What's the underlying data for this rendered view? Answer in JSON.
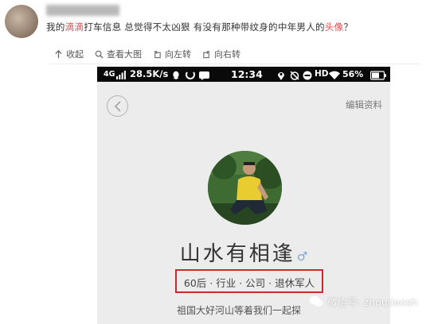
{
  "post": {
    "text_before": "我的",
    "highlight_1": "滴滴",
    "text_middle": "打车信息 总觉得不太凶狠 有没有那种带纹身的中年男人的",
    "highlight_2": "头像",
    "text_after": "？"
  },
  "actions": {
    "collapse": "收起",
    "view_large": "查看大图",
    "rotate_left": "向左转",
    "rotate_right": "向右转"
  },
  "status_bar": {
    "network": "4G",
    "speed": "28.5K/s",
    "time": "12:34",
    "hd": "HD",
    "battery": "56%"
  },
  "profile": {
    "edit_label": "编辑资料",
    "nickname": "山水有相逢",
    "gender_symbol": "♂",
    "tags": "60后 · 行业 · 公司 · 退休军人",
    "bio": "祖国大好河山等着我们一起探"
  },
  "watermark": {
    "text": "微信号: zhoudaosh"
  },
  "colors": {
    "highlight": "#e8474c",
    "box": "#c92a2a"
  }
}
